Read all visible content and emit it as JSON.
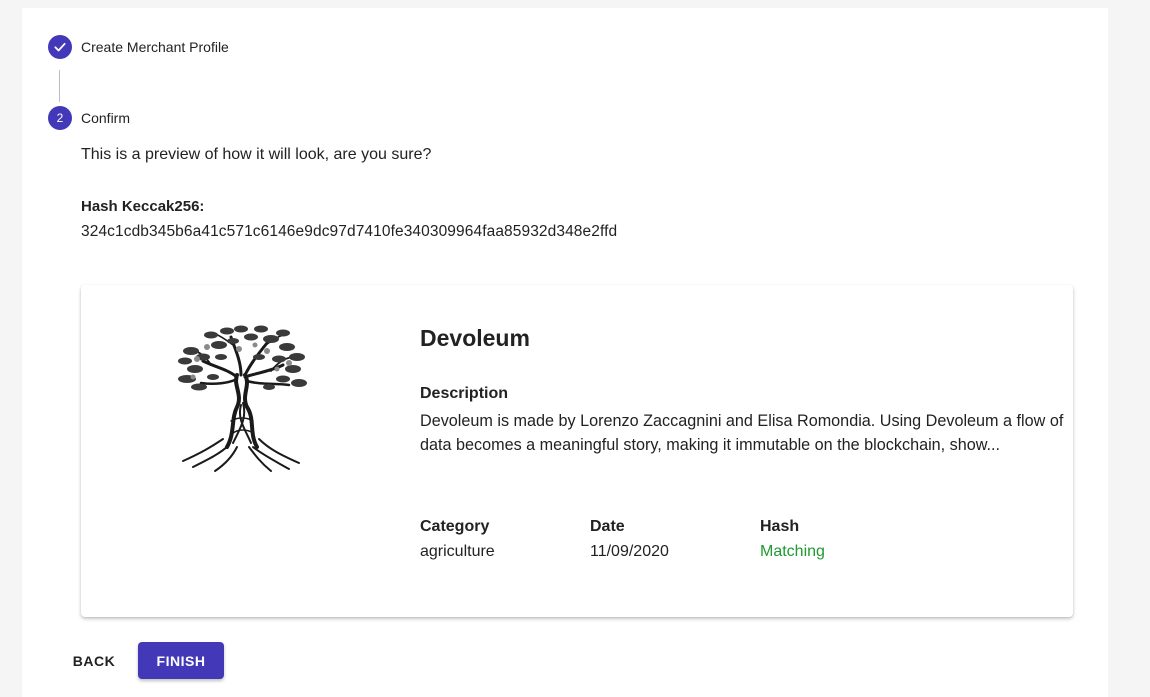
{
  "stepper": {
    "step1": {
      "label": "Create Merchant Profile",
      "icon": "check-icon",
      "state": "completed"
    },
    "step2": {
      "number": "2",
      "label": "Confirm",
      "state": "active"
    }
  },
  "content": {
    "preview_text": "This is a preview of how it will look, are you sure?",
    "hash_title": "Hash Keccak256:",
    "hash_value": "324c1cdb345b6a41c571c6146e9dc97d7410fe340309964faa85932d348e2ffd"
  },
  "card": {
    "image_icon": "olive-tree-illustration",
    "title": "Devoleum",
    "description_label": "Description",
    "description": "Devoleum is made by Lorenzo Zaccagnini and Elisa Romondia. Using Devoleum a flow of data becomes a meaningful story, making it immutable on the blockchain, show...",
    "category_label": "Category",
    "category_value": "agriculture",
    "date_label": "Date",
    "date_value": "11/09/2020",
    "hash_label": "Hash",
    "hash_value": "Matching"
  },
  "actions": {
    "back_label": "BACK",
    "finish_label": "FINISH"
  },
  "colors": {
    "primary": "#4338b8",
    "success": "#1e9a2e",
    "background": "#f5f5f5"
  }
}
